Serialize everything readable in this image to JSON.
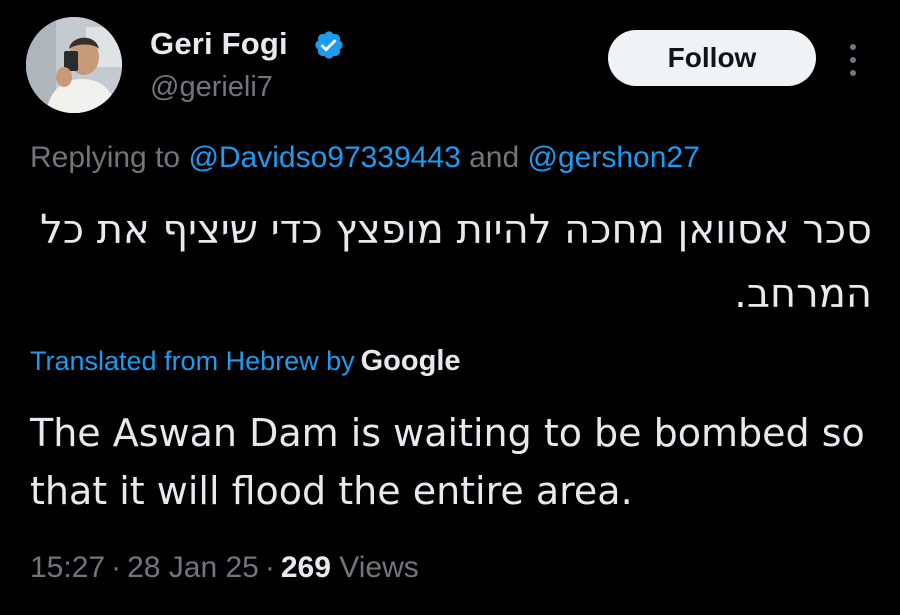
{
  "author": {
    "display_name": "Geri Fogi",
    "handle": "@gerieli7",
    "verified_icon": "verified-badge-icon",
    "avatar_icon": "profile-photo"
  },
  "follow_label": "Follow",
  "more_icon": "more-vertical-icon",
  "reply": {
    "prefix": "Replying to",
    "mention_1": "@Davidso97339443",
    "connector": "and",
    "mention_2": "@gershon27"
  },
  "original_text": "סכר אסוואן מחכה להיות מופצץ כדי שיציף את כל המרחב.",
  "translation": {
    "label": "Translated from Hebrew by",
    "provider": "Google",
    "text": "The Aswan Dam is waiting to be bombed so that it will flood the entire area."
  },
  "meta": {
    "time": "15:27",
    "date": "28 Jan 25",
    "views_count": "269",
    "views_label": "Views",
    "separator": "·"
  },
  "colors": {
    "background": "#000000",
    "text_primary": "#e7e9ea",
    "text_secondary": "#71767b",
    "link": "#1d9bf0",
    "button_bg": "#eff3f4",
    "button_text": "#0f1419"
  }
}
